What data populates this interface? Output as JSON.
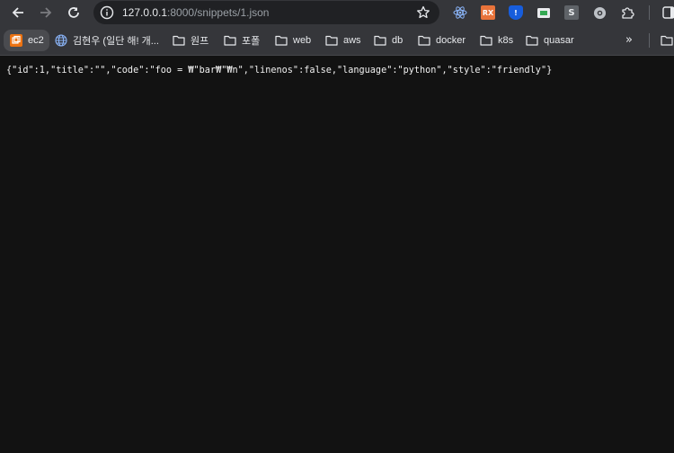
{
  "browser": {
    "url_host": "127.0.0.1",
    "url_path": ":8000/snippets/1.json",
    "extensions": [
      "react-icon",
      "rss-icon",
      "bitwarden-icon",
      "green-card-icon",
      "s-icon",
      "gear-ext-icon",
      "puzzle-icon"
    ]
  },
  "bookmarks": [
    {
      "label": "ec2",
      "icon": "aws-icon"
    },
    {
      "label": "김현우 (일단 해! 개...",
      "icon": "globe-icon"
    },
    {
      "label": "원프",
      "icon": "folder-icon"
    },
    {
      "label": "포폴",
      "icon": "folder-icon"
    },
    {
      "label": "web",
      "icon": "folder-icon"
    },
    {
      "label": "aws",
      "icon": "folder-icon"
    },
    {
      "label": "db",
      "icon": "folder-icon"
    },
    {
      "label": "docker",
      "icon": "folder-icon"
    },
    {
      "label": "k8s",
      "icon": "folder-icon"
    },
    {
      "label": "quasar",
      "icon": "folder-icon"
    }
  ],
  "content": {
    "json_text": "{\"id\":1,\"title\":\"\",\"code\":\"foo = ₩\"bar₩\"₩n\",\"linenos\":false,\"language\":\"python\",\"style\":\"friendly\"}"
  }
}
